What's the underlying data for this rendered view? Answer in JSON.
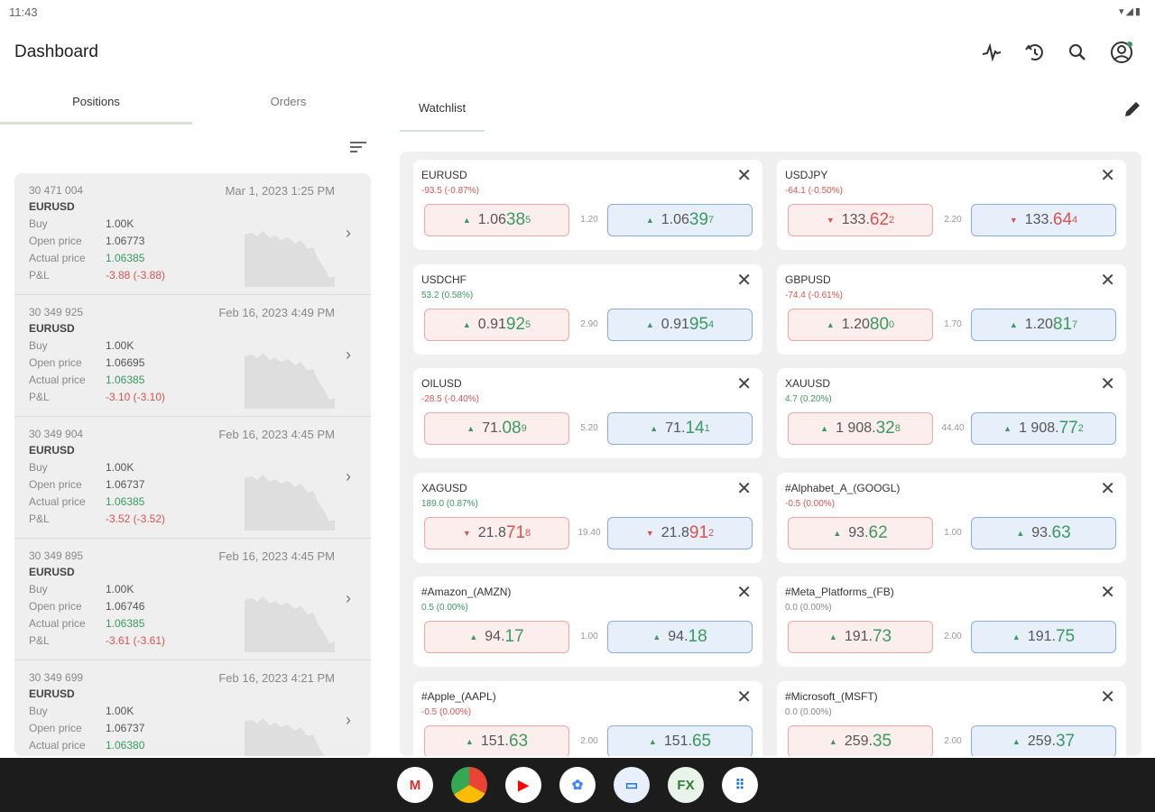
{
  "status": {
    "time": "11:43",
    "icons": "▾◢▮"
  },
  "header": {
    "title": "Dashboard"
  },
  "tabs": {
    "positions": "Positions",
    "orders": "Orders",
    "watchlist": "Watchlist"
  },
  "positions": [
    {
      "id": "30 471 004",
      "date": "Mar 1, 2023 1:25 PM",
      "symbol": "EURUSD",
      "buy_label": "Buy",
      "buy": "1.00K",
      "open_label": "Open price",
      "open": "1.06773",
      "actual_label": "Actual price",
      "actual": "1.06385",
      "pl_label": "P&L",
      "pl": "-3.88 (-3.88)"
    },
    {
      "id": "30 349 925",
      "date": "Feb 16, 2023 4:49 PM",
      "symbol": "EURUSD",
      "buy_label": "Buy",
      "buy": "1.00K",
      "open_label": "Open price",
      "open": "1.06695",
      "actual_label": "Actual price",
      "actual": "1.06385",
      "pl_label": "P&L",
      "pl": "-3.10 (-3.10)"
    },
    {
      "id": "30 349 904",
      "date": "Feb 16, 2023 4:45 PM",
      "symbol": "EURUSD",
      "buy_label": "Buy",
      "buy": "1.00K",
      "open_label": "Open price",
      "open": "1.06737",
      "actual_label": "Actual price",
      "actual": "1.06385",
      "pl_label": "P&L",
      "pl": "-3.52 (-3.52)"
    },
    {
      "id": "30 349 895",
      "date": "Feb 16, 2023 4:45 PM",
      "symbol": "EURUSD",
      "buy_label": "Buy",
      "buy": "1.00K",
      "open_label": "Open price",
      "open": "1.06746",
      "actual_label": "Actual price",
      "actual": "1.06385",
      "pl_label": "P&L",
      "pl": "-3.61 (-3.61)"
    },
    {
      "id": "30 349 699",
      "date": "Feb 16, 2023 4:21 PM",
      "symbol": "EURUSD",
      "buy_label": "Buy",
      "buy": "1.00K",
      "open_label": "Open price",
      "open": "1.06737",
      "actual_label": "Actual price",
      "actual": "1.06380",
      "pl_label": "P&L",
      "pl": ""
    }
  ],
  "watchlist": [
    {
      "symbol": "EURUSD",
      "change": "-93.5 (-0.87%)",
      "change_dir": "red",
      "spread": "1.20",
      "sell": {
        "dir": "up",
        "base": "1.06",
        "big": "38",
        "pip": "5"
      },
      "buy": {
        "dir": "up",
        "base": "1.06",
        "big": "39",
        "pip": "7"
      }
    },
    {
      "symbol": "USDJPY",
      "change": "-64.1 (-0.50%)",
      "change_dir": "red",
      "spread": "2.20",
      "sell": {
        "dir": "down",
        "base": "133.",
        "big": "62",
        "pip": "2"
      },
      "buy": {
        "dir": "down",
        "base": "133.",
        "big": "64",
        "pip": "4"
      }
    },
    {
      "symbol": "USDCHF",
      "change": "53.2 (0.58%)",
      "change_dir": "green",
      "spread": "2.90",
      "sell": {
        "dir": "up",
        "base": "0.91",
        "big": "92",
        "pip": "5"
      },
      "buy": {
        "dir": "up",
        "base": "0.91",
        "big": "95",
        "pip": "4"
      }
    },
    {
      "symbol": "GBPUSD",
      "change": "-74.4 (-0.61%)",
      "change_dir": "red",
      "spread": "1.70",
      "sell": {
        "dir": "up",
        "base": "1.20",
        "big": "80",
        "pip": "0"
      },
      "buy": {
        "dir": "up",
        "base": "1.20",
        "big": "81",
        "pip": "7"
      }
    },
    {
      "symbol": "OILUSD",
      "change": "-28.5 (-0.40%)",
      "change_dir": "red",
      "spread": "5.20",
      "sell": {
        "dir": "up",
        "base": "71.",
        "big": "08",
        "pip": "9"
      },
      "buy": {
        "dir": "up",
        "base": "71.",
        "big": "14",
        "pip": "1"
      }
    },
    {
      "symbol": "XAUUSD",
      "change": "4.7 (0.20%)",
      "change_dir": "green",
      "spread": "44.40",
      "sell": {
        "dir": "up",
        "base": "1 908.",
        "big": "32",
        "pip": "8"
      },
      "buy": {
        "dir": "up",
        "base": "1 908.",
        "big": "77",
        "pip": "2"
      }
    },
    {
      "symbol": "XAGUSD",
      "change": "189.0 (0.87%)",
      "change_dir": "green",
      "spread": "19.40",
      "sell": {
        "dir": "down",
        "base": "21.8",
        "big": "71",
        "pip": "8"
      },
      "buy": {
        "dir": "down",
        "base": "21.8",
        "big": "91",
        "pip": "2"
      }
    },
    {
      "symbol": "#Alphabet_A_(GOOGL)",
      "change": "-0.5 (0.00%)",
      "change_dir": "red",
      "spread": "1.00",
      "sell": {
        "dir": "up",
        "base": "93.",
        "big": "62",
        "pip": ""
      },
      "buy": {
        "dir": "up",
        "base": "93.",
        "big": "63",
        "pip": ""
      }
    },
    {
      "symbol": "#Amazon_(AMZN)",
      "change": "0.5 (0.00%)",
      "change_dir": "green",
      "spread": "1.00",
      "sell": {
        "dir": "up",
        "base": "94.",
        "big": "17",
        "pip": ""
      },
      "buy": {
        "dir": "up",
        "base": "94.",
        "big": "18",
        "pip": ""
      }
    },
    {
      "symbol": "#Meta_Platforms_(FB)",
      "change": "0.0 (0.00%)",
      "change_dir": "gray",
      "spread": "2.00",
      "sell": {
        "dir": "up",
        "base": "191.",
        "big": "73",
        "pip": ""
      },
      "buy": {
        "dir": "up",
        "base": "191.",
        "big": "75",
        "pip": ""
      }
    },
    {
      "symbol": "#Apple_(AAPL)",
      "change": "-0.5 (0.00%)",
      "change_dir": "red",
      "spread": "2.00",
      "sell": {
        "dir": "up",
        "base": "151.",
        "big": "63",
        "pip": ""
      },
      "buy": {
        "dir": "up",
        "base": "151.",
        "big": "65",
        "pip": ""
      }
    },
    {
      "symbol": "#Microsoft_(MSFT)",
      "change": "0.0 (0.00%)",
      "change_dir": "gray",
      "spread": "2.00",
      "sell": {
        "dir": "up",
        "base": "259.",
        "big": "35",
        "pip": ""
      },
      "buy": {
        "dir": "up",
        "base": "259.",
        "big": "37",
        "pip": ""
      }
    }
  ],
  "colors": {
    "green": "#3a9a5f",
    "red": "#d9534f",
    "buy_bg": "#e6effa",
    "sell_bg": "#fdeeee"
  },
  "dock": [
    {
      "name": "gmail-icon",
      "glyph": "M"
    },
    {
      "name": "chrome-icon",
      "glyph": ""
    },
    {
      "name": "youtube-icon",
      "glyph": "▶"
    },
    {
      "name": "photos-icon",
      "glyph": "✿"
    },
    {
      "name": "messages-icon",
      "glyph": "▭"
    },
    {
      "name": "fxpro-icon",
      "glyph": "FX"
    },
    {
      "name": "app-drawer-icon",
      "glyph": "⠿"
    }
  ]
}
